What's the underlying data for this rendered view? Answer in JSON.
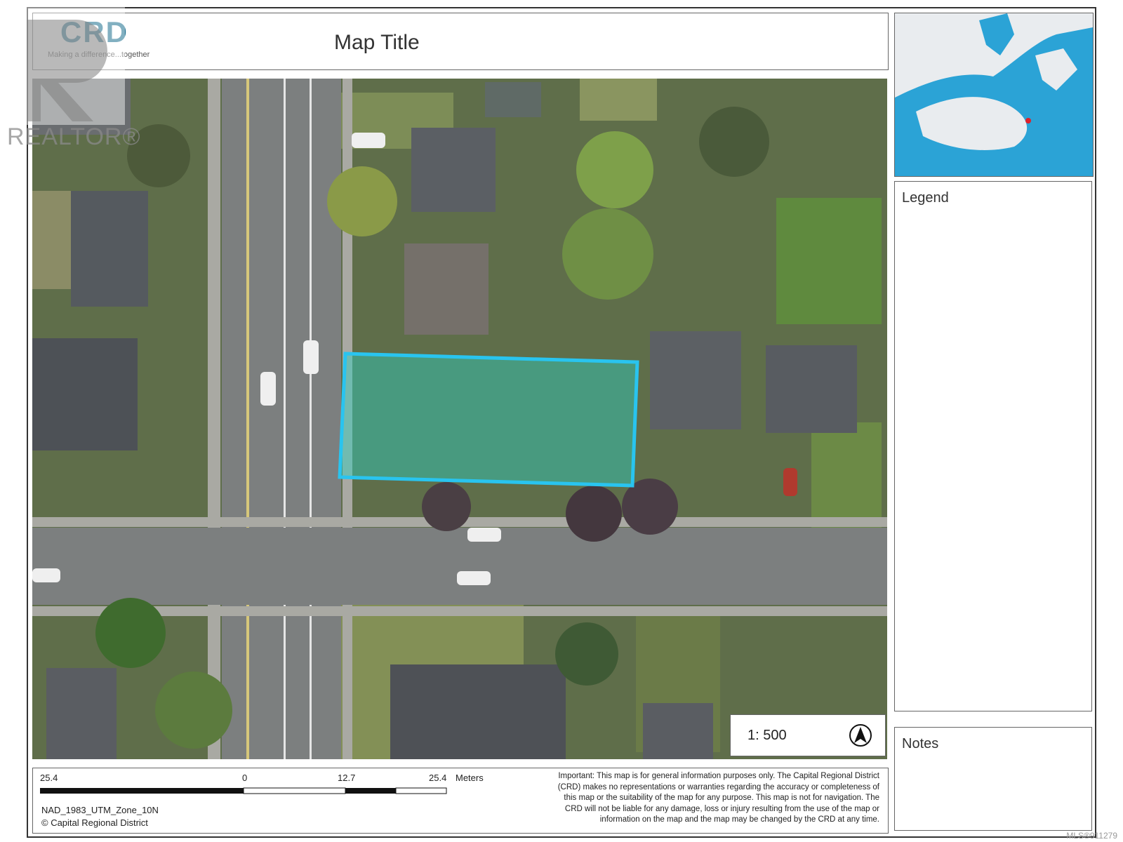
{
  "header": {
    "logo_text": "CRD",
    "logo_tagline": "Making a difference...together",
    "map_title": "Map Title"
  },
  "legend": {
    "title": "Legend"
  },
  "notes": {
    "title": "Notes"
  },
  "scale": {
    "ratio": "1: 500"
  },
  "scalebar": {
    "labels": [
      "25.4",
      "0",
      "12.7",
      "25.4"
    ],
    "unit": "Meters"
  },
  "footer": {
    "projection": "NAD_1983_UTM_Zone_10N",
    "copyright": "© Capital Regional District",
    "disclaimer": "Important: This map is for general information purposes only. The Capital Regional District (CRD) makes no representations or warranties regarding the accuracy or completeness of this map or the suitability of the map for any purpose. This map is not for navigation. The CRD will not be liable for any damage, loss or injury resulting from the use of the map or information on the map and the map may be changed by the CRD at any time."
  },
  "watermark": {
    "text": "REALTOR®",
    "mls": "MLS®911279"
  },
  "colors": {
    "parcel_outline": "#29c4ef",
    "logo": "#1d6f8f"
  }
}
